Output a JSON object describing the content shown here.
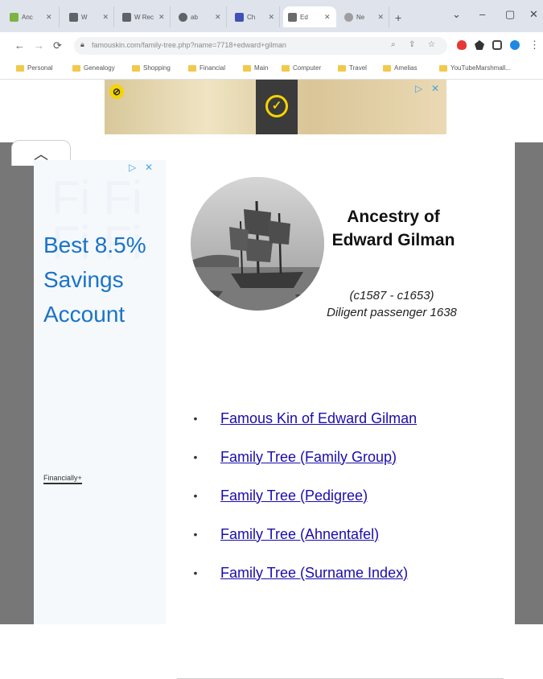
{
  "tabs": [
    {
      "label": "Anc",
      "favicon_color": "#7cb342"
    },
    {
      "label": "W",
      "favicon_color": "#5f6368"
    },
    {
      "label": "W Rec",
      "favicon_color": "#5f6368"
    },
    {
      "label": "ab",
      "favicon_color": "#5f6368"
    },
    {
      "label": "Ch",
      "favicon_color": "#3f51b5"
    },
    {
      "label": "Ed",
      "favicon_color": "#6b6b6b"
    },
    {
      "label": "Ne",
      "favicon_color": "#9e9e9e"
    }
  ],
  "window_controls": {
    "minimize": "–",
    "maximize": "▢",
    "close": "✕",
    "menu": "⌄"
  },
  "toolbar": {
    "back": "←",
    "forward": "→",
    "reload": "⟳",
    "url": "famouskin.com/family-tree.php?name=7718+edward+gilman"
  },
  "bookmarks": [
    {
      "label": "Personal"
    },
    {
      "label": "Genealogy"
    },
    {
      "label": "Shopping"
    },
    {
      "label": "Financial"
    },
    {
      "label": "Main"
    },
    {
      "label": "Computer"
    },
    {
      "label": "Travel"
    },
    {
      "label": "Amelias"
    },
    {
      "label": "YouTubeMarshmall..."
    }
  ],
  "ad_top": {
    "badge": "⊘",
    "check": "✓",
    "adchoices": "▷",
    "close": "✕"
  },
  "ad_side": {
    "adchoices": "▷",
    "close": "✕",
    "headline": "Best 8.5% Savings Account",
    "brand": "Financially+"
  },
  "collapse_tab": {
    "chevron": "︿"
  },
  "page": {
    "title": "Ancestry of Edward Gilman",
    "subtitle_dates": "(c1587 - c1653)",
    "subtitle_role": "Diligent passenger 1638",
    "links": [
      {
        "label": "Famous Kin of Edward Gilman"
      },
      {
        "label": "Family Tree (Family Group)"
      },
      {
        "label": "Family Tree (Pedigree)"
      },
      {
        "label": "Family Tree (Ahnentafel)"
      },
      {
        "label": "Family Tree (Surname Index)"
      }
    ],
    "bullet": "•"
  },
  "colors": {
    "link": "#1a0dab",
    "ad_headline": "#1a73c8",
    "tabstrip_bg": "#dfe3eb",
    "scrollbar_grey": "#777777"
  }
}
